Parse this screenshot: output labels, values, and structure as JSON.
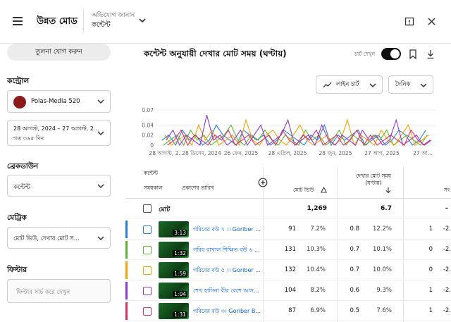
{
  "header": {
    "app_name": "উন্নত মোড",
    "context_label": "অভিযোগ জানান",
    "context_value": "কন্টেন্ট"
  },
  "sidebar": {
    "compare_button": "তুলনা যোগ করুন",
    "control_heading": "কন্ট্রোল",
    "channel_name": "Polas-Media 520",
    "date_range": "28 আগস্ট, 2024 – 27 আগস্ট, 2...",
    "date_range_sub": "গত ৩৬৫ দিন",
    "breakdown_heading": "ব্রেকডাউন",
    "breakdown_value": "কন্টেন্ট",
    "metric_heading": "মেট্রিক",
    "metric_value": "মোট ভিউ, দেখার মোট স...",
    "filter_heading": "ফিল্টার",
    "filter_placeholder": "ফিল্টার সার্চ করে দেখুন"
  },
  "main": {
    "title": "কন্টেন্ট অনুযায়ী দেখার মোট সময় (ঘণ্টায়)",
    "toggle_label": "চার্ট দেখুন",
    "chart_type": "লাইন চার্ট",
    "interval": "দৈনিক"
  },
  "chart_data": {
    "type": "line",
    "ylim": [
      0,
      0.07
    ],
    "yticks": [
      "0.07",
      "0.04",
      "0.02",
      "0"
    ],
    "xticks": [
      "28 আগস্ট, 2...",
      "28 ডিসেম, 2024",
      "26 ফেব, 2025",
      "28 এপ্রিল, 2025",
      "28 জুন, 2025",
      "27 আগ, 2025",
      "27 আ..."
    ],
    "series": [
      {
        "color": "#2e7dd7",
        "values": [
          0.01,
          0.02,
          0.0,
          0.03,
          0.01,
          0.02,
          0.0,
          0.01,
          0.04,
          0.02,
          0.01,
          0.0,
          0.03,
          0.02,
          0.01,
          0.02,
          0.0,
          0.01,
          0.03,
          0.02,
          0.01,
          0.0,
          0.02,
          0.01,
          0.04,
          0.0,
          0.02,
          0.01,
          0.02,
          0.03,
          0.0,
          0.01,
          0.02,
          0.0,
          0.01,
          0.03,
          0.02,
          0.0,
          0.01,
          0.03
        ]
      },
      {
        "color": "#5fb236",
        "values": [
          0.0,
          0.01,
          0.02,
          0.0,
          0.03,
          0.01,
          0.02,
          0.0,
          0.01,
          0.02,
          0.04,
          0.01,
          0.0,
          0.02,
          0.01,
          0.03,
          0.01,
          0.0,
          0.02,
          0.01,
          0.0,
          0.03,
          0.01,
          0.02,
          0.0,
          0.01,
          0.03,
          0.0,
          0.02,
          0.01,
          0.0,
          0.02,
          0.01,
          0.03,
          0.0,
          0.01,
          0.02,
          0.01,
          0.0,
          0.02
        ]
      },
      {
        "color": "#f0a30a",
        "values": [
          0.02,
          0.0,
          0.01,
          0.02,
          0.0,
          0.04,
          0.01,
          0.03,
          0.0,
          0.01,
          0.02,
          0.0,
          0.05,
          0.01,
          0.0,
          0.02,
          0.03,
          0.01,
          0.0,
          0.02,
          0.04,
          0.01,
          0.0,
          0.01,
          0.02,
          0.0,
          0.01,
          0.05,
          0.0,
          0.02,
          0.01,
          0.0,
          0.03,
          0.01,
          0.0,
          0.02,
          0.04,
          0.0,
          0.01,
          0.02
        ]
      },
      {
        "color": "#8e3ccb",
        "values": [
          0.01,
          0.03,
          0.0,
          0.02,
          0.01,
          0.0,
          0.06,
          0.01,
          0.02,
          0.0,
          0.01,
          0.03,
          0.0,
          0.02,
          0.04,
          0.0,
          0.01,
          0.02,
          0.05,
          0.0,
          0.01,
          0.02,
          0.0,
          0.04,
          0.01,
          0.0,
          0.02,
          0.01,
          0.0,
          0.03,
          0.01,
          0.02,
          0.0,
          0.01,
          0.05,
          0.0,
          0.01,
          0.02,
          0.0,
          0.01
        ]
      },
      {
        "color": "#d6336c",
        "values": [
          0.0,
          0.01,
          0.03,
          0.0,
          0.02,
          0.01,
          0.0,
          0.02,
          0.01,
          0.03,
          0.0,
          0.01,
          0.02,
          0.0,
          0.01,
          0.02,
          0.0,
          0.03,
          0.01,
          0.0,
          0.02,
          0.01,
          0.03,
          0.0,
          0.01,
          0.02,
          0.0,
          0.01,
          0.03,
          0.0,
          0.02,
          0.0,
          0.01,
          0.02,
          0.01,
          0.0,
          0.03,
          0.01,
          0.0,
          0.01
        ]
      }
    ]
  },
  "table": {
    "col_content": "কন্টেন্ট",
    "col_duration": "সময়কাল",
    "col_published": "প্রকাশের তারিখ",
    "col_views": "মোট ভিউ",
    "col_watch_time": "দেখার মোট সময় (ঘণ্টায়)",
    "col_next": "সং",
    "total_label": "মোট",
    "total_views": "1,269",
    "total_watch": "6.7",
    "total_next": "–",
    "rows": [
      {
        "color": "#2e7dd7",
        "duration": "3:13",
        "title": "গরিবের বউ ৭ ।। Goriber ...",
        "views": "91",
        "views_pct": "7.2%",
        "watch": "0.8",
        "watch_pct": "12.2%",
        "n1": "1",
        "n2": "-2."
      },
      {
        "color": "#5fb236",
        "duration": "1:32",
        "title": "গরিব রাখাল শিক্ষিত বউ ৬ ...",
        "views": "131",
        "views_pct": "10.3%",
        "watch": "0.7",
        "watch_pct": "10.1%",
        "n1": "0",
        "n2": "-2."
      },
      {
        "color": "#f0a30a",
        "duration": "1:59",
        "title": "গরিবের বউ ৫ ।। Goriber ...",
        "views": "132",
        "views_pct": "10.4%",
        "watch": "0.7",
        "watch_pct": "10.0%",
        "n1": "0",
        "n2": "-2."
      },
      {
        "color": "#8e3ccb",
        "duration": "1:04",
        "title": "শেখ হাসিনা বীর বেশে আস...",
        "views": "104",
        "views_pct": "8.2%",
        "watch": "0.6",
        "watch_pct": "9.3%",
        "n1": "1",
        "n2": "-2."
      },
      {
        "color": "#d6336c",
        "duration": "1:31",
        "title": "গরিবের বউ ৩। Goriber B...",
        "views": "87",
        "views_pct": "6.9%",
        "watch": "0.5",
        "watch_pct": "7.6%",
        "n1": "1",
        "n2": "-2."
      }
    ]
  }
}
